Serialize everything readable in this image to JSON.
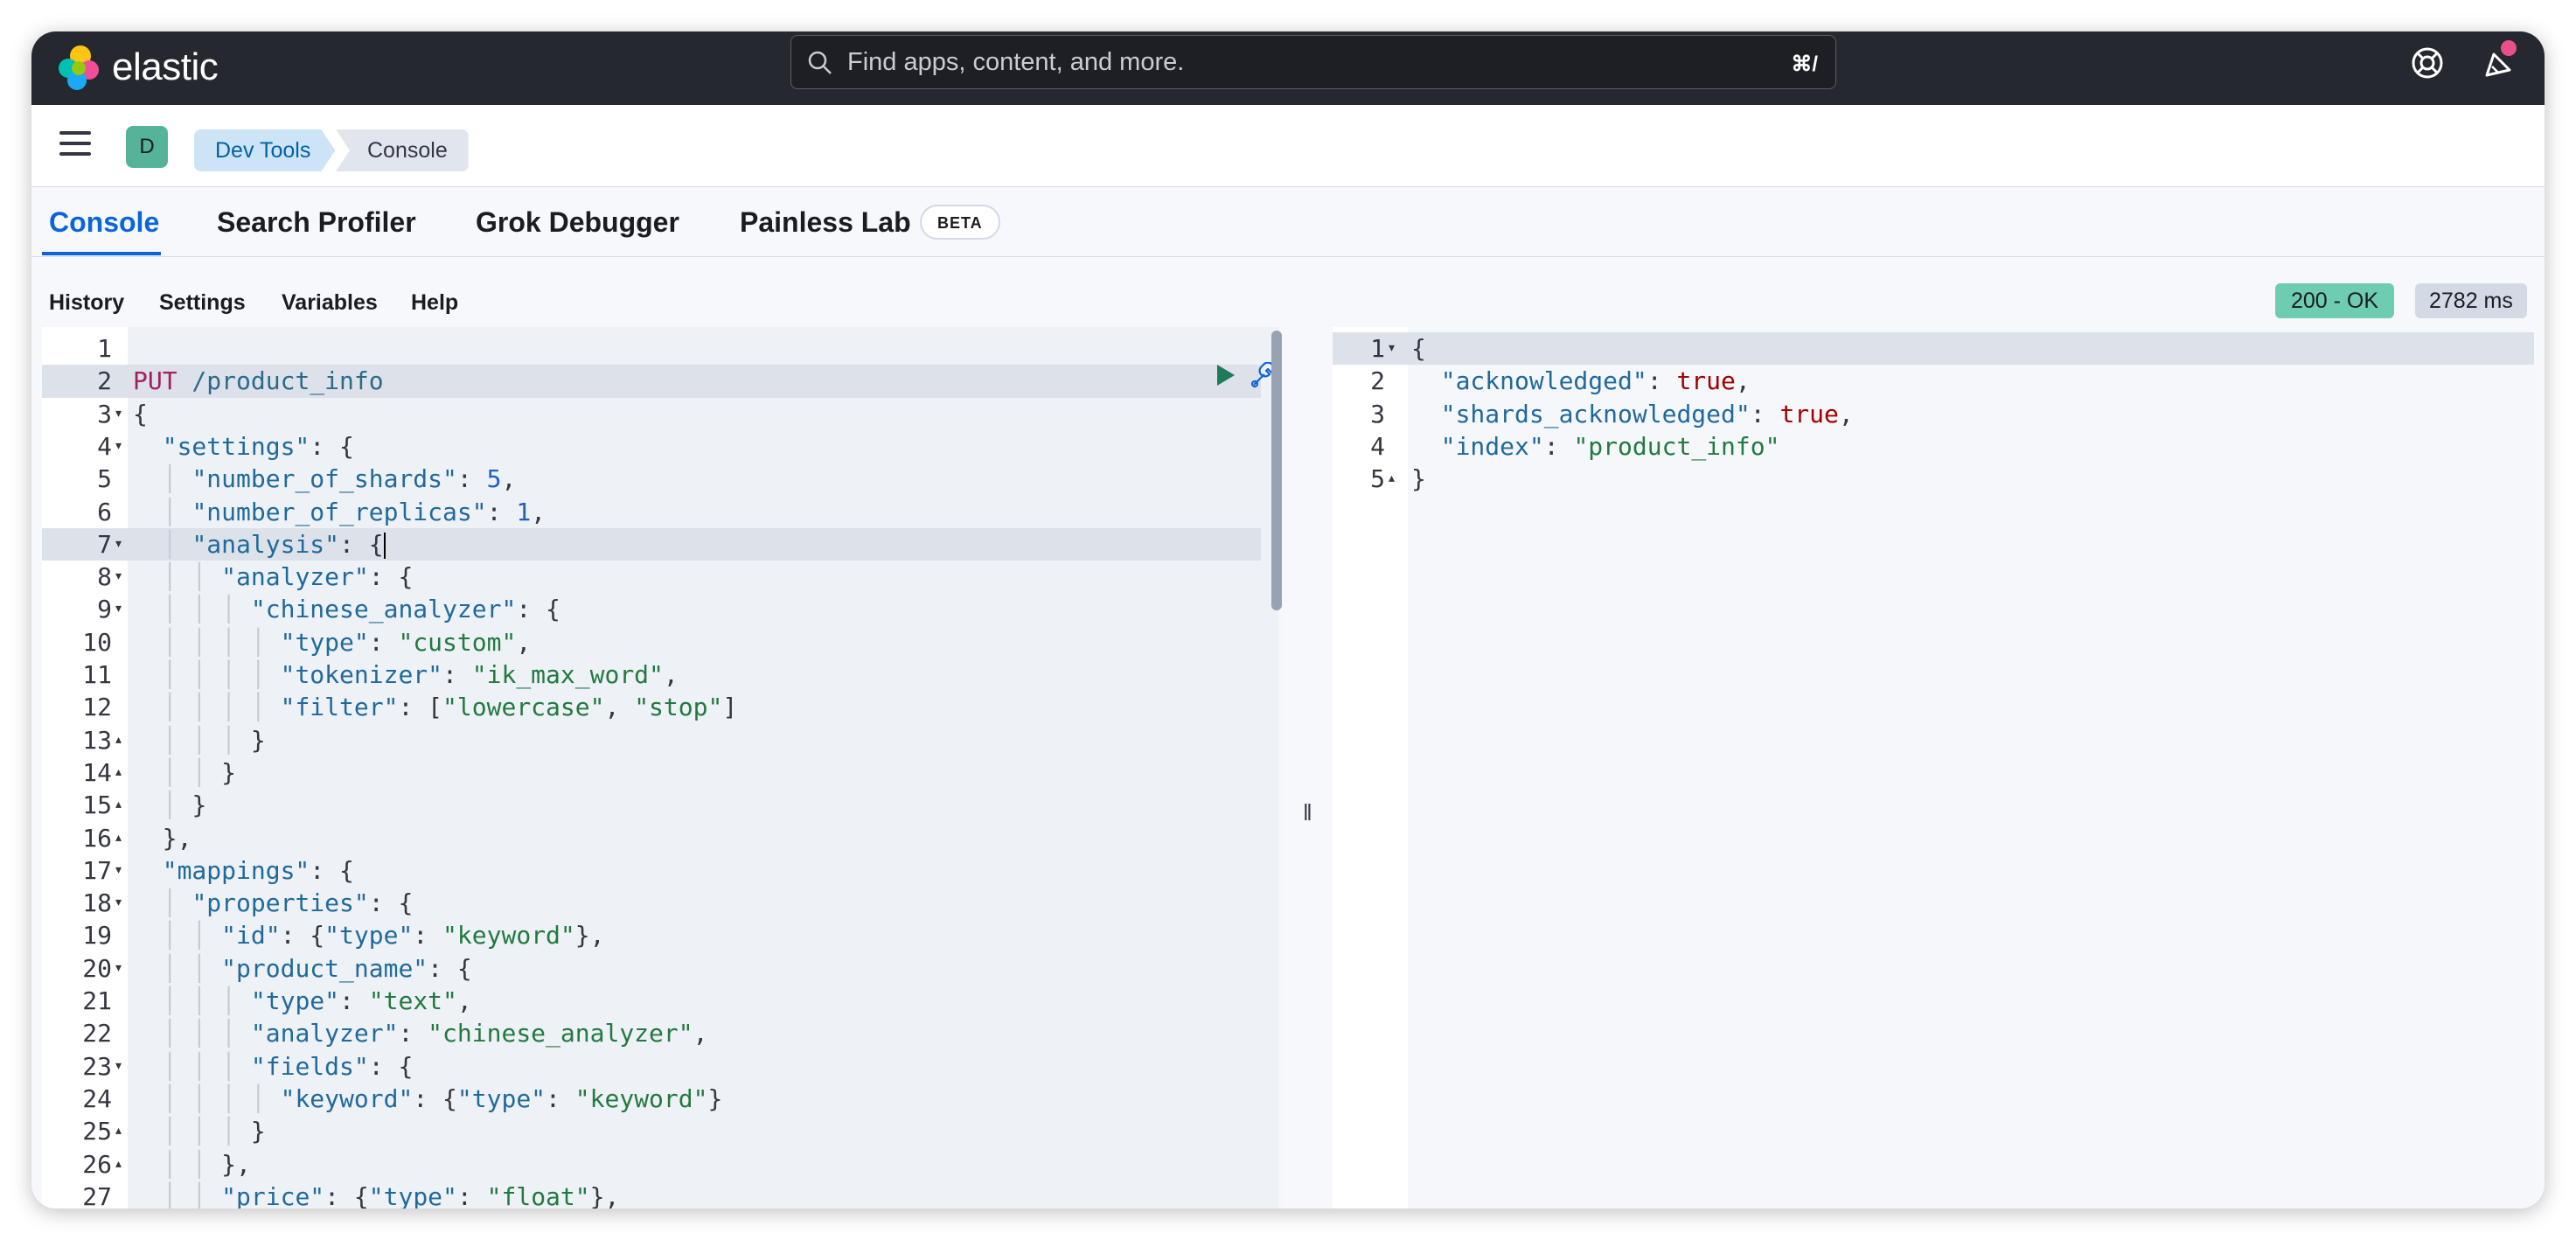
{
  "topbar": {
    "brand": "elastic",
    "search_placeholder": "Find apps, content, and more.",
    "search_shortcut": "⌘/"
  },
  "header": {
    "avatar_letter": "D",
    "breadcrumbs": [
      "Dev Tools",
      "Console"
    ]
  },
  "tabs": [
    {
      "label": "Console",
      "active": true
    },
    {
      "label": "Search Profiler",
      "active": false
    },
    {
      "label": "Grok Debugger",
      "active": false
    },
    {
      "label": "Painless Lab",
      "active": false
    }
  ],
  "beta_badge": "BETA",
  "toolbar": {
    "items": [
      "History",
      "Settings",
      "Variables",
      "Help"
    ],
    "status": "200 - OK",
    "duration": "2782 ms"
  },
  "colors": {
    "topbar_bg": "#25282f",
    "active_tab": "#0b64dd",
    "status_ok": "#6dccb1"
  },
  "editor": {
    "lines": [
      {
        "n": "1",
        "fold": ""
      },
      {
        "n": "2",
        "fold": ""
      },
      {
        "n": "3",
        "fold": "▾"
      },
      {
        "n": "4",
        "fold": "▾"
      },
      {
        "n": "5",
        "fold": ""
      },
      {
        "n": "6",
        "fold": ""
      },
      {
        "n": "7",
        "fold": "▾"
      },
      {
        "n": "8",
        "fold": "▾"
      },
      {
        "n": "9",
        "fold": "▾"
      },
      {
        "n": "10",
        "fold": ""
      },
      {
        "n": "11",
        "fold": ""
      },
      {
        "n": "12",
        "fold": ""
      },
      {
        "n": "13",
        "fold": "▴"
      },
      {
        "n": "14",
        "fold": "▴"
      },
      {
        "n": "15",
        "fold": "▴"
      },
      {
        "n": "16",
        "fold": "▴"
      },
      {
        "n": "17",
        "fold": "▾"
      },
      {
        "n": "18",
        "fold": "▾"
      },
      {
        "n": "19",
        "fold": ""
      },
      {
        "n": "20",
        "fold": "▾"
      },
      {
        "n": "21",
        "fold": ""
      },
      {
        "n": "22",
        "fold": ""
      },
      {
        "n": "23",
        "fold": "▾"
      },
      {
        "n": "24",
        "fold": ""
      },
      {
        "n": "25",
        "fold": "▴"
      },
      {
        "n": "26",
        "fold": "▴"
      },
      {
        "n": "27",
        "fold": ""
      }
    ],
    "code": {
      "method": "PUT",
      "url": " /product_info",
      "settings": "\"settings\"",
      "number_of_shards": "\"number_of_shards\"",
      "shards_val": "5",
      "number_of_replicas": "\"number_of_replicas\"",
      "replicas_val": "1",
      "analysis": "\"analysis\"",
      "analyzer": "\"analyzer\"",
      "chinese_analyzer": "\"chinese_analyzer\"",
      "type": "\"type\"",
      "custom": "\"custom\"",
      "tokenizer": "\"tokenizer\"",
      "ik_max_word": "\"ik_max_word\"",
      "filter": "\"filter\"",
      "lowercase": "\"lowercase\"",
      "stop": "\"stop\"",
      "mappings": "\"mappings\"",
      "properties": "\"properties\"",
      "id": "\"id\"",
      "keyword_str": "\"keyword\"",
      "product_name": "\"product_name\"",
      "text": "\"text\"",
      "analyzer_val": "\"chinese_analyzer\"",
      "fields": "\"fields\"",
      "keyword_key": "\"keyword\"",
      "price": "\"price\"",
      "float": "\"float\""
    }
  },
  "output": {
    "lines": [
      {
        "n": "1",
        "fold": "▾"
      },
      {
        "n": "2",
        "fold": ""
      },
      {
        "n": "3",
        "fold": ""
      },
      {
        "n": "4",
        "fold": ""
      },
      {
        "n": "5",
        "fold": "▴"
      }
    ],
    "acknowledged": "\"acknowledged\"",
    "shards_acknowledged": "\"shards_acknowledged\"",
    "index": "\"index\"",
    "index_val": "\"product_info\"",
    "true_val": "true"
  }
}
